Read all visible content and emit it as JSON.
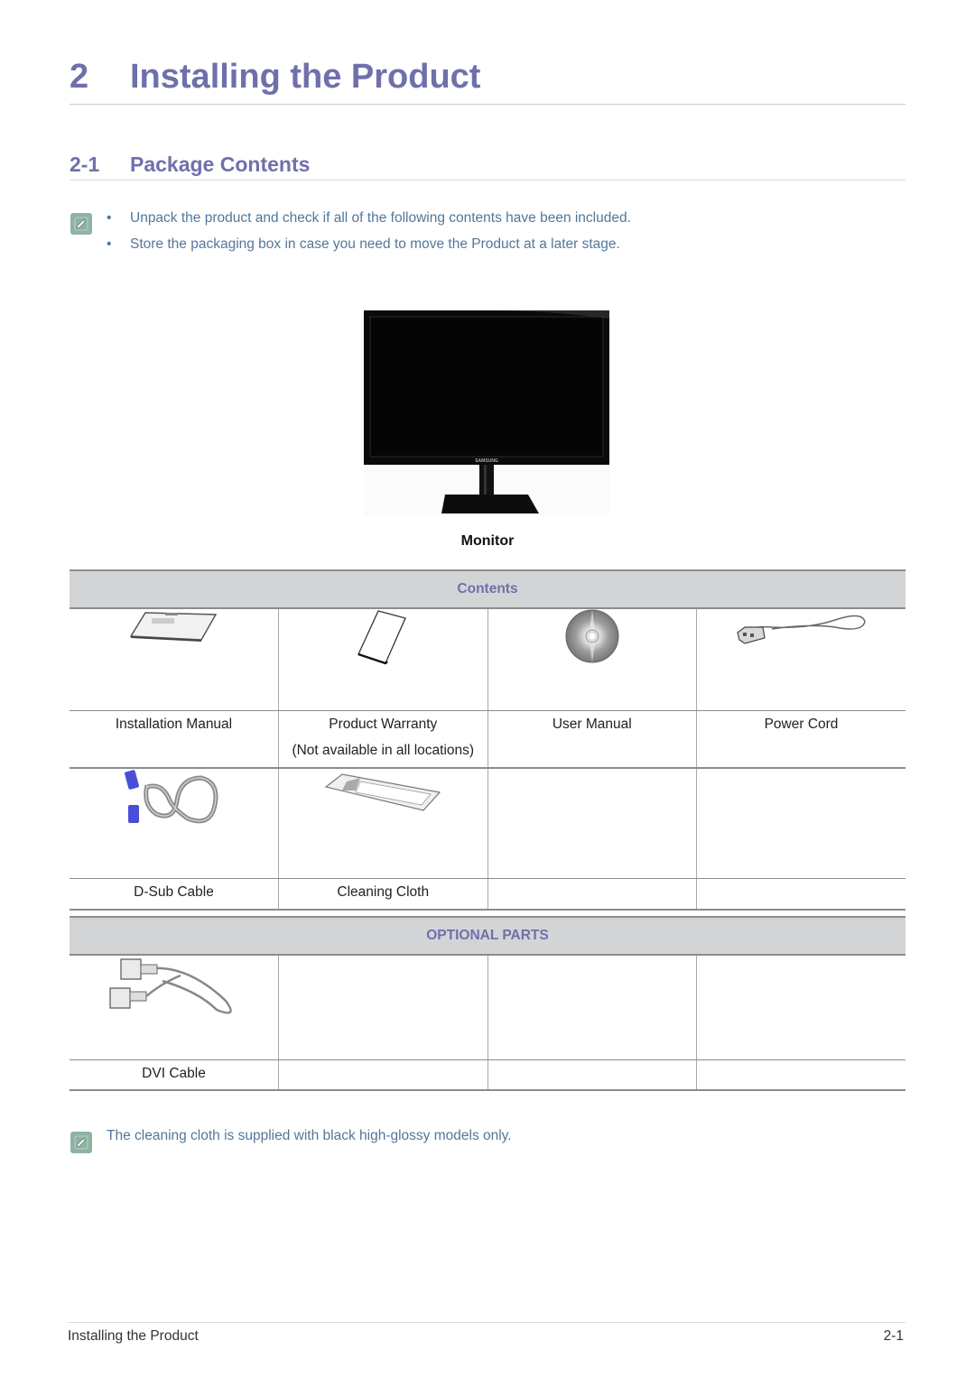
{
  "chapter": {
    "number": "2",
    "title": "Installing the Product"
  },
  "section": {
    "number": "2-1",
    "title": "Package Contents"
  },
  "notes": {
    "icon": "note-pencil-icon",
    "bullets": [
      "Unpack the product and check if all of the following contents have been included.",
      "Store the packaging box in case you need to move the Product at a later stage."
    ]
  },
  "monitor": {
    "label": "Monitor",
    "brand": "SAMSUNG"
  },
  "contents_table": {
    "header": "Contents",
    "rows": [
      {
        "items": [
          {
            "icon": "installation-manual-icon",
            "label": "Installation Manual",
            "sublabel": ""
          },
          {
            "icon": "product-warranty-icon",
            "label": "Product Warranty",
            "sublabel": "(Not available in all locations)"
          },
          {
            "icon": "cd-disc-icon",
            "label": "User Manual",
            "sublabel": ""
          },
          {
            "icon": "power-cord-icon",
            "label": "Power Cord",
            "sublabel": ""
          }
        ]
      },
      {
        "items": [
          {
            "icon": "dsub-cable-icon",
            "label": "D-Sub Cable",
            "sublabel": ""
          },
          {
            "icon": "cleaning-cloth-icon",
            "label": "Cleaning Cloth",
            "sublabel": ""
          },
          {
            "icon": "",
            "label": "",
            "sublabel": ""
          },
          {
            "icon": "",
            "label": "",
            "sublabel": ""
          }
        ]
      }
    ]
  },
  "optional_table": {
    "header": "OPTIONAL PARTS",
    "items": [
      {
        "icon": "dvi-cable-icon",
        "label": "DVI Cable"
      },
      {
        "icon": "",
        "label": ""
      },
      {
        "icon": "",
        "label": ""
      },
      {
        "icon": "",
        "label": ""
      }
    ]
  },
  "footnote": "The cleaning cloth is supplied with black high-glossy models only.",
  "footer": {
    "left": "Installing the Product",
    "page": "2-1"
  },
  "colors": {
    "heading": "#6f70ab",
    "note_text": "#52779a",
    "header_bg": "#d3d4d6",
    "note_icon_bg": "#8fb3a3"
  }
}
